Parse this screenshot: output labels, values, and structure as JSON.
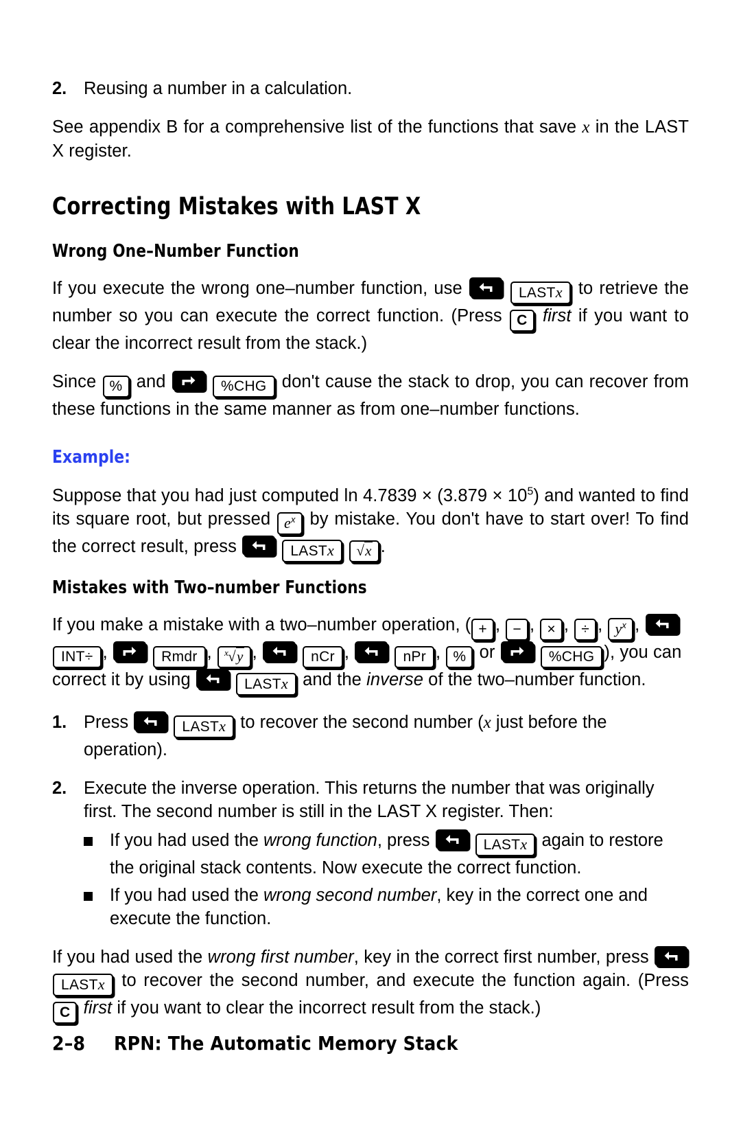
{
  "page": {
    "item2_number": "2.",
    "item2_text": "Reusing a number in a calculation.",
    "appendix_p1": "See appendix B for a comprehensive list of the functions that save ",
    "appendix_var": "x",
    "appendix_p2": " in the LAST X register."
  },
  "section": {
    "title": "Correcting Mistakes with LAST X"
  },
  "wrong_one": {
    "title": "Wrong One–Number Function",
    "p1_a": "If you execute the wrong one–number function, use",
    "p1_b": "to retrieve the number so you can execute the correct function. (Press",
    "p1_c_italic": "first",
    "p1_d": "if you want to clear the incorrect result from the stack.)",
    "p2_a": "Since",
    "p2_b": "and",
    "p2_c": "don't cause the stack to drop, you can recover from these functions in the same manner as from one–number functions."
  },
  "example": {
    "title": "Example:",
    "a": "Suppose that you had just computed ln 4.7839 × (3.879 × 10",
    "exp": "5",
    "b": ") and wanted to find its square root, but pressed",
    "c": "by mistake. You don't have to start over! To find the correct result, press",
    "d": "."
  },
  "two_number": {
    "title": "Mistakes with Two–number Functions",
    "p_a": "If you make a mistake with a two–number operation, (",
    "p_or": "or",
    "p_b": "),",
    "p_c": "you can correct it by using",
    "p_d": "and the",
    "p_d_italic": "inverse",
    "p_e": "of the two–number function."
  },
  "steps": [
    {
      "number": "1.",
      "a": "Press",
      "b": "to recover the second number (",
      "var": "x",
      "c": " just before the operation)."
    },
    {
      "number": "2.",
      "a": "Execute the inverse operation. This returns the number that was originally first. The second number is still in the LAST X register. Then:"
    }
  ],
  "bullets": [
    {
      "a": "If you had used the",
      "italic": "wrong function",
      "b": ", press",
      "c": "again to restore the original stack contents. Now execute the correct function."
    },
    {
      "a": "If you had used the",
      "italic": "wrong second number",
      "b": ", key in the correct one and execute the function."
    }
  ],
  "closing": {
    "a": "If you had used the",
    "a_italic": "wrong first number",
    "b": ", key in the correct first number, press",
    "c": "to recover the second number, and execute the function again. (Press",
    "c_italic": "first",
    "d": "if you want to clear the incorrect result from the stack.)"
  },
  "keys": {
    "shift_left": "shift-left-key",
    "shift_right": "shift-right-key",
    "lastx": "LAST",
    "lastx_var": "x",
    "clear": "C",
    "percent": "%",
    "pct_chg": "%CHG",
    "ex_base": "e",
    "ex_exp": "x",
    "sqrt_var": "x",
    "plus": "+",
    "minus": "−",
    "times": "×",
    "divide": "÷",
    "yx_base": "y",
    "yx_exp": "x",
    "int_div": "INT÷",
    "rmdr": "Rmdr",
    "xrooty_pre": "x",
    "xrooty_body": "y",
    "ncr": "nCr",
    "npr": "nPr"
  },
  "footer": {
    "page_number": "2–8",
    "chapter": "RPN: The Automatic Memory Stack"
  },
  "colors": {
    "example_blue": "#2b41f0",
    "text_black": "#000000",
    "page_bg": "#ffffff"
  }
}
